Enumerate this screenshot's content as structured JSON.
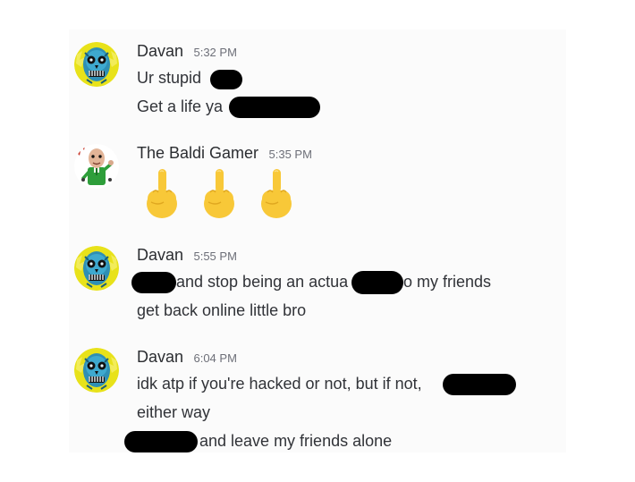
{
  "messages": [
    {
      "username": "Davan",
      "time": "5:32 PM",
      "avatar_icon": "zombie-face-avatar",
      "lines": [
        "Ur stupid",
        "Get a life ya"
      ]
    },
    {
      "username": "The Baldi Gamer",
      "time": "5:35 PM",
      "avatar_icon": "baldi-character-avatar",
      "emojis": [
        "middle-finger-emoji",
        "middle-finger-emoji",
        "middle-finger-emoji"
      ]
    },
    {
      "username": "Davan",
      "time": "5:55 PM",
      "avatar_icon": "zombie-face-avatar",
      "lines": [
        "and stop being an actua",
        "o my friends",
        "get back online little bro"
      ]
    },
    {
      "username": "Davan",
      "time": "6:04 PM",
      "avatar_icon": "zombie-face-avatar",
      "lines": [
        "idk atp if you're hacked or not, but if not,",
        "either way",
        "and leave my friends alone"
      ]
    }
  ],
  "colors": {
    "panel_bg": "#fbfbfb",
    "username": "#2b2d31",
    "timestamp": "#6d6f78",
    "text": "#313338",
    "redaction": "#000000",
    "emoji_yellow": "#f8c838"
  }
}
